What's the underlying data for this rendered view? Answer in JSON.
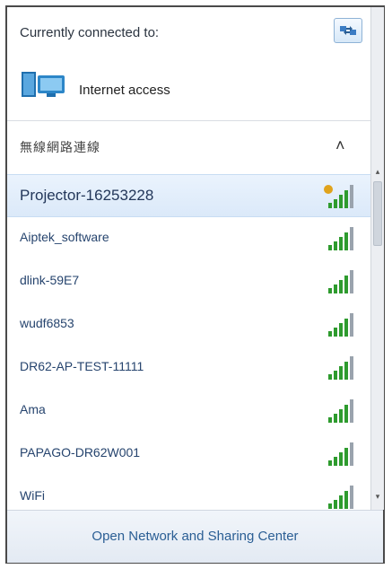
{
  "header": {
    "connected_label": "Currently connected to:",
    "connection_status": "Internet access",
    "refresh_icon": "refresh-network-icon",
    "network_icon": "network-computer-icon"
  },
  "section": {
    "title": "無線網路連線",
    "chevron": "˄"
  },
  "networks": [
    {
      "name": "Projector-16253228",
      "selected": true,
      "icon": "signal-secured-icon"
    },
    {
      "name": "Aiptek_software",
      "selected": false,
      "icon": "signal-icon"
    },
    {
      "name": "dlink-59E7",
      "selected": false,
      "icon": "signal-icon"
    },
    {
      "name": "wudf6853",
      "selected": false,
      "icon": "signal-icon"
    },
    {
      "name": "DR62-AP-TEST-11111",
      "selected": false,
      "icon": "signal-icon"
    },
    {
      "name": "Ama",
      "selected": false,
      "icon": "signal-icon"
    },
    {
      "name": "PAPAGO-DR62W001",
      "selected": false,
      "icon": "signal-icon"
    },
    {
      "name": "WiFi",
      "selected": false,
      "icon": "signal-icon"
    }
  ],
  "scrollbar": {
    "up": "▴",
    "down": "▾"
  },
  "footer": {
    "link_label": "Open Network and Sharing Center"
  },
  "colors": {
    "accent": "#2a5e94",
    "signal": "#2e9b2e",
    "selected_bg": "#dbe9f9"
  }
}
